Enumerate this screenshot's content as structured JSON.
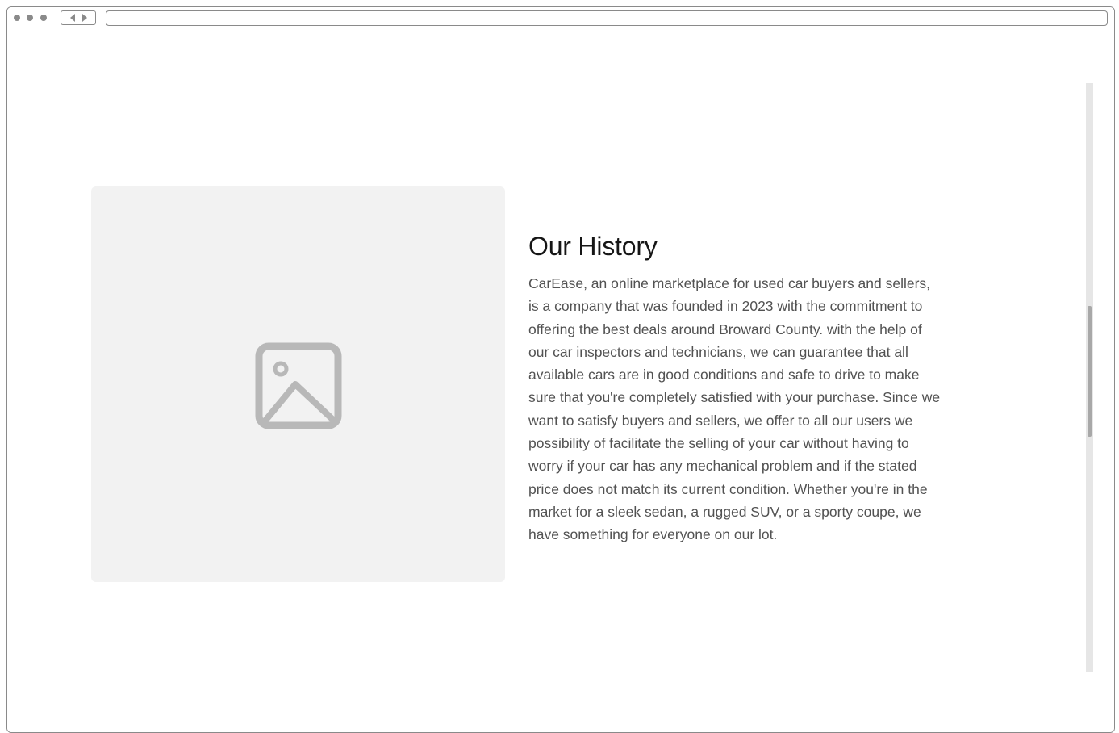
{
  "browser": {
    "url": ""
  },
  "icons": {
    "image_placeholder": "image-icon",
    "back": "chevron-left-icon",
    "forward": "chevron-right-icon"
  },
  "colors": {
    "placeholder_bg": "#f2f2f2",
    "placeholder_icon": "#b8b8b8",
    "heading": "#161616",
    "body": "#525252"
  },
  "history": {
    "title": "Our History",
    "body": "CarEase, an online marketplace for used car buyers and sellers, is a company that was founded in 2023 with the commitment to offering the best deals around Broward County. with the help of our car inspectors and technicians, we can guarantee that all available cars are in good conditions and safe to drive to make sure that you're completely satisfied with your purchase. Since we want to satisfy buyers and sellers, we offer to all our users we possibility of facilitate the selling of your car without having to worry if your car has any mechanical problem and if the stated price does not match its current condition. Whether you're in the market for a sleek sedan, a rugged SUV, or a sporty coupe, we have something for everyone on our lot."
  }
}
